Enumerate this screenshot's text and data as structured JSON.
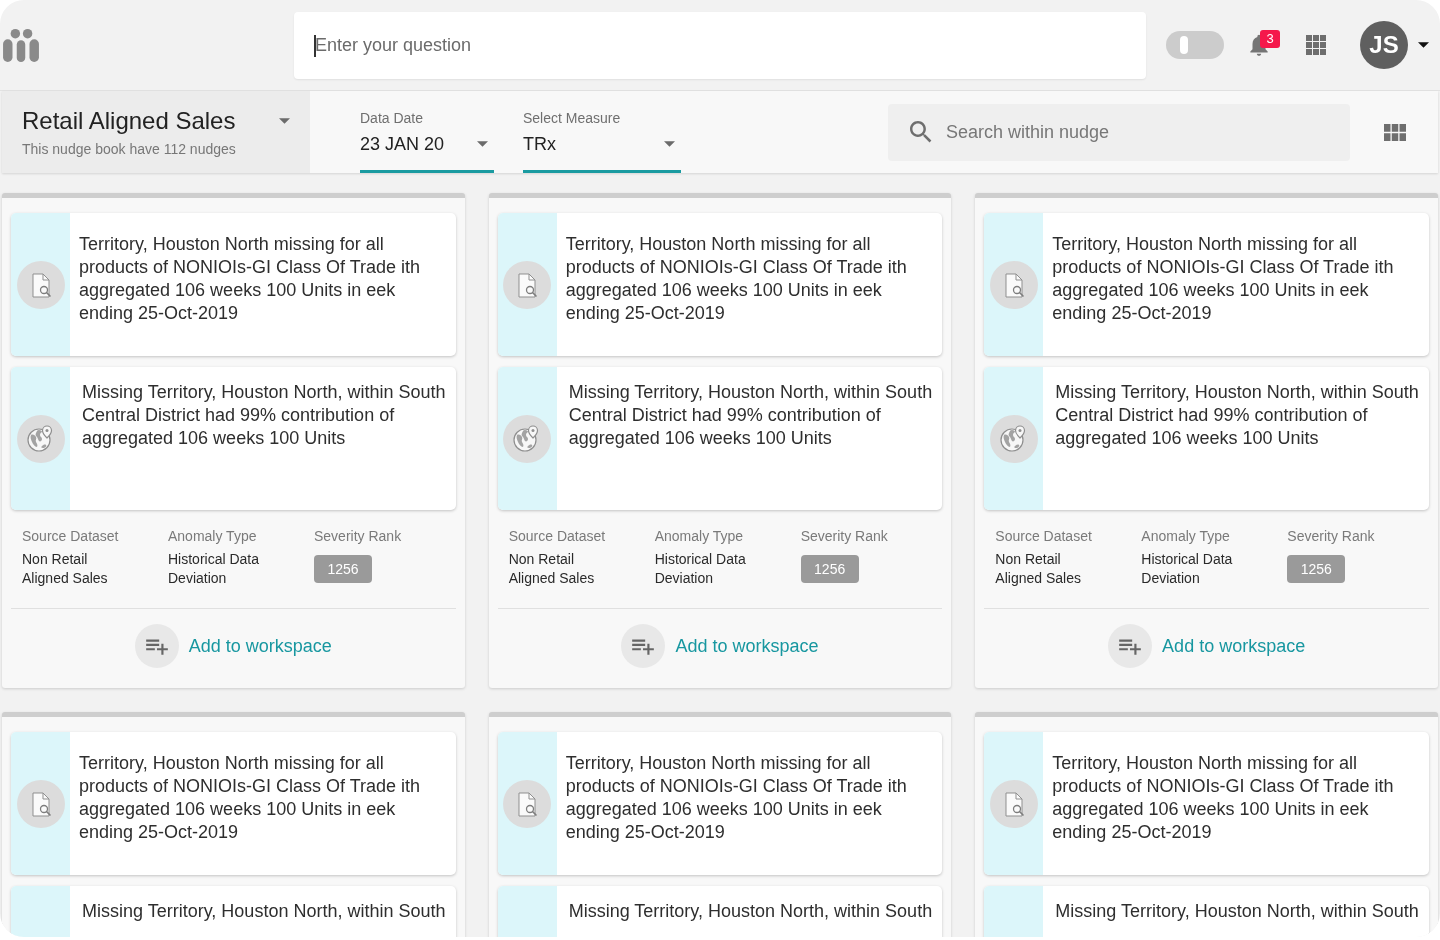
{
  "header": {
    "question_field": {
      "placeholder": "Enter your question",
      "focused": true
    },
    "toggle": {
      "on": false
    },
    "notification_badge": "3",
    "avatar_initials": "JS"
  },
  "nudge_book": {
    "title": "Retail Aligned Sales",
    "subtitle": "This nudge book have 112 nudges"
  },
  "filters": [
    {
      "label": "Data Date",
      "value": "23 JAN 20"
    },
    {
      "label": "Select Measure",
      "value": "TRx"
    }
  ],
  "search": {
    "placeholder": "Search within nudge"
  },
  "cards": [
    {
      "findings": [
        {
          "kind": "product",
          "text": "Territory, Houston North missing for all products of NONIOIs-GI Class Of Trade ith aggregated 106 weeks 100 Units in eek ending 25-Oct-2019"
        },
        {
          "kind": "territory",
          "text": "Missing Territory, Houston North, within South Central District had 99% contribution of aggregated 106 weeks 100 Units"
        }
      ],
      "fields": [
        {
          "kind": "text",
          "label": "Source Dataset",
          "value": "Non Retail Aligned Sales"
        },
        {
          "kind": "text",
          "label": "Anomaly Type",
          "value": "Historical Data Deviation"
        },
        {
          "kind": "badge",
          "label": "Severity Rank",
          "value": "1256"
        }
      ],
      "action": "Add to workspace"
    },
    {
      "findings": [
        {
          "kind": "product",
          "text": "Territory, Houston North missing for all products of NONIOIs-GI Class Of Trade ith aggregated 106 weeks 100 Units in eek ending 25-Oct-2019"
        },
        {
          "kind": "territory",
          "text": "Missing Territory, Houston North, within South Central District had 99% contribution of aggregated 106 weeks 100 Units"
        }
      ],
      "fields": [
        {
          "kind": "text",
          "label": "Source Dataset",
          "value": "Non Retail Aligned Sales"
        },
        {
          "kind": "text",
          "label": "Anomaly Type",
          "value": "Historical Data Deviation"
        },
        {
          "kind": "badge",
          "label": "Severity Rank",
          "value": "1256"
        }
      ],
      "action": "Add to workspace"
    },
    {
      "findings": [
        {
          "kind": "product",
          "text": "Territory, Houston North missing for all products of NONIOIs-GI Class Of Trade ith aggregated 106 weeks 100 Units in eek ending 25-Oct-2019"
        },
        {
          "kind": "territory",
          "text": "Missing Territory, Houston North, within South Central District had 99% contribution of aggregated 106 weeks 100 Units"
        }
      ],
      "fields": [
        {
          "kind": "text",
          "label": "Source Dataset",
          "value": "Non Retail Aligned Sales"
        },
        {
          "kind": "text",
          "label": "Anomaly Type",
          "value": "Historical Data Deviation"
        },
        {
          "kind": "badge",
          "label": "Severity Rank",
          "value": "1256"
        }
      ],
      "action": "Add to workspace"
    },
    {
      "findings": [
        {
          "kind": "product",
          "text": "Territory, Houston North missing for all products of NONIOIs-GI Class Of Trade ith aggregated 106 weeks 100 Units in eek ending 25-Oct-2019"
        },
        {
          "text": "Missing Territory, Houston North, within South"
        }
      ]
    },
    {
      "findings": [
        {
          "kind": "product",
          "text": "Territory, Houston North missing for all products of NONIOIs-GI Class Of Trade ith aggregated 106 weeks 100 Units in eek ending 25-Oct-2019"
        },
        {
          "text": "Missing Territory, Houston North, within South"
        }
      ]
    },
    {
      "findings": [
        {
          "kind": "product",
          "text": "Territory, Houston North missing for all products of NONIOIs-GI Class Of Trade ith aggregated 106 weeks 100 Units in eek ending 25-Oct-2019"
        },
        {
          "text": "Missing Territory, Houston North, within South"
        }
      ]
    }
  ]
}
